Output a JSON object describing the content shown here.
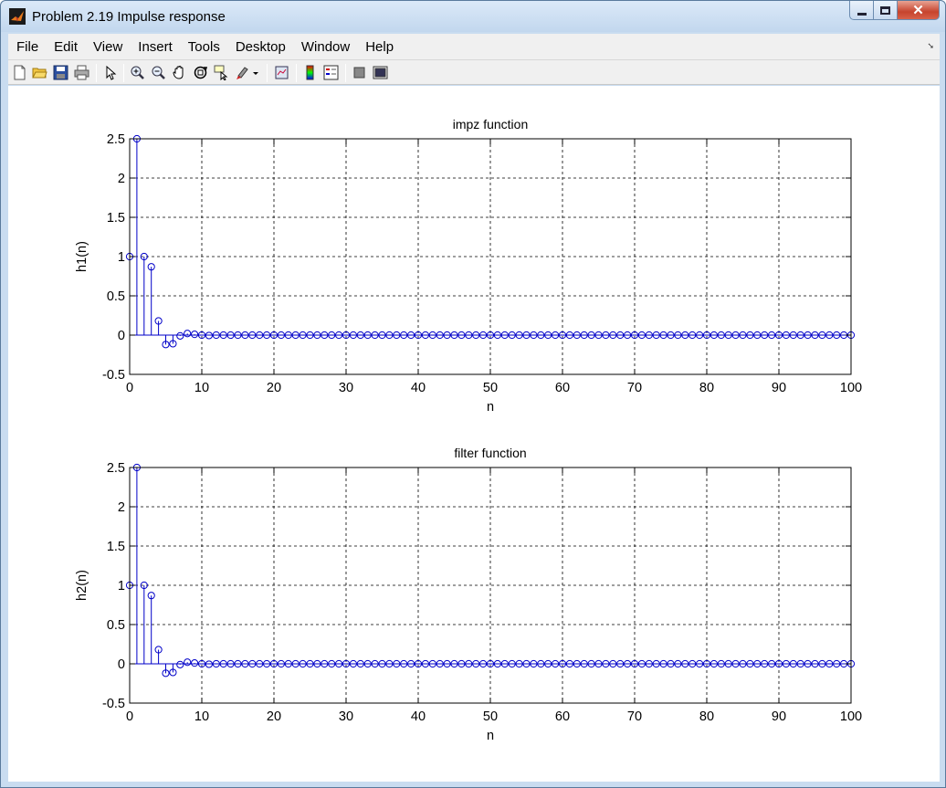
{
  "window": {
    "title": "Problem 2.19 Impulse response",
    "controls": {
      "minimize": "minimize",
      "maximize": "maximize",
      "close": "close"
    }
  },
  "menubar": {
    "items": [
      {
        "label": "File"
      },
      {
        "label": "Edit"
      },
      {
        "label": "View"
      },
      {
        "label": "Insert"
      },
      {
        "label": "Tools"
      },
      {
        "label": "Desktop"
      },
      {
        "label": "Window"
      },
      {
        "label": "Help"
      }
    ]
  },
  "toolbar": {
    "buttons": [
      {
        "icon": "new-figure-icon"
      },
      {
        "icon": "open-file-icon"
      },
      {
        "icon": "save-icon"
      },
      {
        "icon": "print-icon"
      },
      {
        "icon": "edit-plot-arrow-icon"
      },
      {
        "icon": "zoom-in-icon"
      },
      {
        "icon": "zoom-out-icon"
      },
      {
        "icon": "pan-hand-icon"
      },
      {
        "icon": "rotate-3d-icon"
      },
      {
        "icon": "data-cursor-icon"
      },
      {
        "icon": "brush-icon"
      },
      {
        "icon": "brush-dropdown-icon"
      },
      {
        "icon": "link-plot-icon"
      },
      {
        "icon": "colorbar-icon"
      },
      {
        "icon": "legend-icon"
      },
      {
        "icon": "hide-plot-tools-icon"
      },
      {
        "icon": "show-plot-tools-icon"
      }
    ]
  },
  "chart_data": [
    {
      "type": "stem",
      "title": "impz function",
      "xlabel": "n",
      "ylabel": "h1(n)",
      "xlim": [
        0,
        100
      ],
      "ylim": [
        -0.5,
        2.5
      ],
      "xticks": [
        "0",
        "10",
        "20",
        "30",
        "40",
        "50",
        "60",
        "70",
        "80",
        "90",
        "100"
      ],
      "yticks": [
        "2.5",
        "2",
        "1.5",
        "1",
        "0.5",
        "0",
        "-0.5"
      ],
      "grid": true,
      "color": "#0000c8",
      "x_start": 0,
      "values": [
        1,
        2.5,
        1,
        0.87,
        0.18,
        -0.12,
        -0.11,
        -0.01,
        0.02,
        0.01,
        0,
        -0.005,
        0,
        0,
        0,
        0,
        0,
        0,
        0,
        0,
        0,
        0,
        0,
        0,
        0,
        0,
        0,
        0,
        0,
        0,
        0,
        0,
        0,
        0,
        0,
        0,
        0,
        0,
        0,
        0,
        0,
        0,
        0,
        0,
        0,
        0,
        0,
        0,
        0,
        0,
        0,
        0,
        0,
        0,
        0,
        0,
        0,
        0,
        0,
        0,
        0,
        0,
        0,
        0,
        0,
        0,
        0,
        0,
        0,
        0,
        0,
        0,
        0,
        0,
        0,
        0,
        0,
        0,
        0,
        0,
        0,
        0,
        0,
        0,
        0,
        0,
        0,
        0,
        0,
        0,
        0,
        0,
        0,
        0,
        0,
        0,
        0,
        0,
        0,
        0,
        0
      ]
    },
    {
      "type": "stem",
      "title": "filter function",
      "xlabel": "n",
      "ylabel": "h2(n)",
      "xlim": [
        0,
        100
      ],
      "ylim": [
        -0.5,
        2.5
      ],
      "xticks": [
        "0",
        "10",
        "20",
        "30",
        "40",
        "50",
        "60",
        "70",
        "80",
        "90",
        "100"
      ],
      "yticks": [
        "2.5",
        "2",
        "1.5",
        "1",
        "0.5",
        "0",
        "-0.5"
      ],
      "grid": true,
      "color": "#0000c8",
      "x_start": 0,
      "values": [
        1,
        2.5,
        1,
        0.87,
        0.18,
        -0.12,
        -0.11,
        -0.01,
        0.02,
        0.01,
        0,
        -0.005,
        0,
        0,
        0,
        0,
        0,
        0,
        0,
        0,
        0,
        0,
        0,
        0,
        0,
        0,
        0,
        0,
        0,
        0,
        0,
        0,
        0,
        0,
        0,
        0,
        0,
        0,
        0,
        0,
        0,
        0,
        0,
        0,
        0,
        0,
        0,
        0,
        0,
        0,
        0,
        0,
        0,
        0,
        0,
        0,
        0,
        0,
        0,
        0,
        0,
        0,
        0,
        0,
        0,
        0,
        0,
        0,
        0,
        0,
        0,
        0,
        0,
        0,
        0,
        0,
        0,
        0,
        0,
        0,
        0,
        0,
        0,
        0,
        0,
        0,
        0,
        0,
        0,
        0,
        0,
        0,
        0,
        0,
        0,
        0,
        0,
        0,
        0,
        0,
        0
      ]
    }
  ]
}
